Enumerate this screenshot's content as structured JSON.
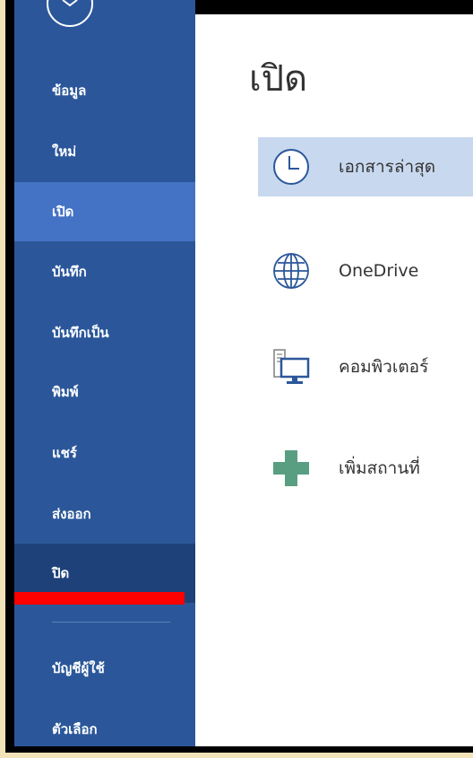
{
  "sidebar": {
    "back_icon": "back-arrow-icon",
    "items": [
      {
        "label": "ข้อมูล"
      },
      {
        "label": "ใหม่"
      },
      {
        "label": "เปิด"
      },
      {
        "label": "บันทึก"
      },
      {
        "label": "บันทึกเป็น"
      },
      {
        "label": "พิมพ์"
      },
      {
        "label": "แชร์"
      },
      {
        "label": "ส่งออก"
      },
      {
        "label": "ปิด"
      },
      {
        "label": "บัญชีผู้ใช้"
      },
      {
        "label": "ตัวเลือก"
      }
    ],
    "selected_index": 2,
    "colors": {
      "background": "#2b579a",
      "selected": "#4472c4",
      "hover": "#1e4179",
      "annotation_underline": "#ff0000"
    }
  },
  "main": {
    "title": "เปิด",
    "places": [
      {
        "label": "เอกสารล่าสุด",
        "icon": "clock-icon"
      },
      {
        "label": "OneDrive",
        "icon": "globe-icon"
      },
      {
        "label": "คอมพิวเตอร์",
        "icon": "computer-icon"
      },
      {
        "label": "เพิ่มสถานที่",
        "icon": "plus-icon"
      }
    ],
    "colors": {
      "selected": "#c8d8ef",
      "accent": "#2b579a",
      "plus": "#5a9e82"
    }
  }
}
